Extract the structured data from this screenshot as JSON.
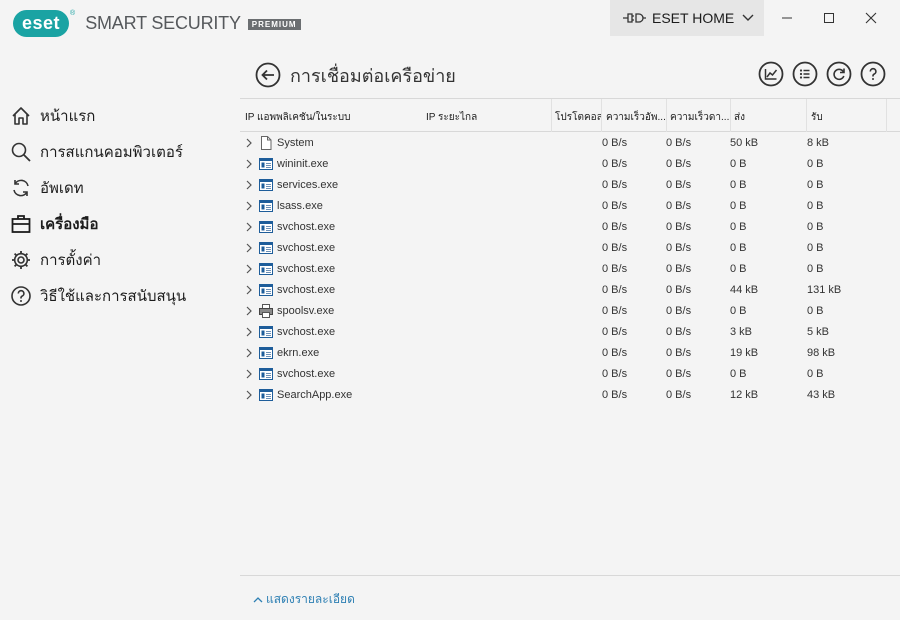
{
  "app": {
    "logo_text": "eset",
    "logo_reg": "®",
    "product": "SMART SECURITY",
    "tier": "PREMIUM",
    "home_button": "ESET HOME"
  },
  "sidebar": {
    "items": [
      {
        "label": "หน้าแรก",
        "icon": "home-icon"
      },
      {
        "label": "การสแกนคอมพิวเตอร์",
        "icon": "search-icon"
      },
      {
        "label": "อัพเดท",
        "icon": "refresh-icon"
      },
      {
        "label": "เครื่องมือ",
        "icon": "briefcase-icon"
      },
      {
        "label": "การตั้งค่า",
        "icon": "gear-icon"
      },
      {
        "label": "วิธีใช้และการสนับสนุน",
        "icon": "help-icon"
      }
    ]
  },
  "page": {
    "title": "การเชื่อมต่อเครือข่าย",
    "show_details": "แสดงรายละเอียด"
  },
  "table": {
    "columns": {
      "app_ip": "IP แอพพลิเคชัน/ในระบบ",
      "remote_ip": "IP ระยะไกล",
      "protocol": "โปรโตคอล",
      "in_speed": "ความเร็วอัพ...",
      "out_speed": "ความเร็วดา...",
      "sent": "ส่ง",
      "received": "รับ"
    },
    "rows": [
      {
        "name": "System",
        "icon": "file-icon",
        "in": "0 B/s",
        "out": "0 B/s",
        "sent": "50 kB",
        "recv": "8 kB"
      },
      {
        "name": "wininit.exe",
        "icon": "app-window-icon",
        "in": "0 B/s",
        "out": "0 B/s",
        "sent": "0 B",
        "recv": "0 B"
      },
      {
        "name": "services.exe",
        "icon": "app-window-icon",
        "in": "0 B/s",
        "out": "0 B/s",
        "sent": "0 B",
        "recv": "0 B"
      },
      {
        "name": "lsass.exe",
        "icon": "app-window-icon",
        "in": "0 B/s",
        "out": "0 B/s",
        "sent": "0 B",
        "recv": "0 B"
      },
      {
        "name": "svchost.exe",
        "icon": "app-window-icon",
        "in": "0 B/s",
        "out": "0 B/s",
        "sent": "0 B",
        "recv": "0 B"
      },
      {
        "name": "svchost.exe",
        "icon": "app-window-icon",
        "in": "0 B/s",
        "out": "0 B/s",
        "sent": "0 B",
        "recv": "0 B"
      },
      {
        "name": "svchost.exe",
        "icon": "app-window-icon",
        "in": "0 B/s",
        "out": "0 B/s",
        "sent": "0 B",
        "recv": "0 B"
      },
      {
        "name": "svchost.exe",
        "icon": "app-window-icon",
        "in": "0 B/s",
        "out": "0 B/s",
        "sent": "44 kB",
        "recv": "131 kB"
      },
      {
        "name": "spoolsv.exe",
        "icon": "printer-icon",
        "in": "0 B/s",
        "out": "0 B/s",
        "sent": "0 B",
        "recv": "0 B"
      },
      {
        "name": "svchost.exe",
        "icon": "app-window-icon",
        "in": "0 B/s",
        "out": "0 B/s",
        "sent": "3 kB",
        "recv": "5 kB"
      },
      {
        "name": "ekrn.exe",
        "icon": "app-window-icon",
        "in": "0 B/s",
        "out": "0 B/s",
        "sent": "19 kB",
        "recv": "98 kB"
      },
      {
        "name": "svchost.exe",
        "icon": "app-window-icon",
        "in": "0 B/s",
        "out": "0 B/s",
        "sent": "0 B",
        "recv": "0 B"
      },
      {
        "name": "SearchApp.exe",
        "icon": "app-window-icon",
        "in": "0 B/s",
        "out": "0 B/s",
        "sent": "12 kB",
        "recv": "43 kB"
      }
    ]
  },
  "colors": {
    "brand": "#1aa3a3",
    "link": "#2d7fb3",
    "background": "#f4f4f4"
  }
}
